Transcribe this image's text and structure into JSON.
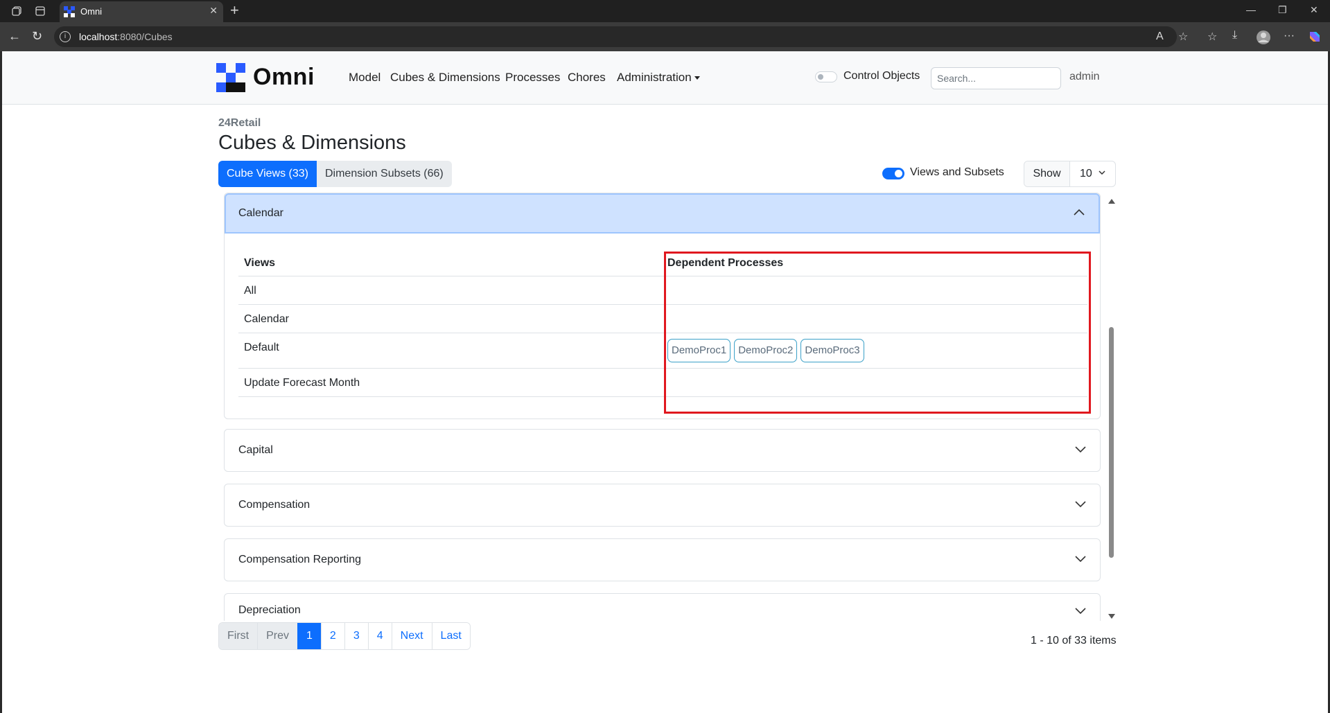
{
  "browser": {
    "tab_title": "Omni",
    "url_host": "localhost",
    "url_path": ":8080/Cubes"
  },
  "navbar": {
    "brand": "Omni",
    "links": [
      "Model",
      "Cubes & Dimensions",
      "Processes",
      "Chores",
      "Administration"
    ],
    "control_objects_label": "Control Objects",
    "control_objects_on": false,
    "search_placeholder": "Search...",
    "user": "admin"
  },
  "page": {
    "breadcrumb": "24Retail",
    "title": "Cubes & Dimensions",
    "tabs": [
      "Cube Views (33)",
      "Dimension Subsets (66)"
    ],
    "views_subsets_label": "Views and Subsets",
    "views_subsets_on": true,
    "show_label": "Show",
    "show_value": "10"
  },
  "accordion": {
    "open": {
      "title": "Calendar",
      "views_header": "Views",
      "deps_header": "Dependent Processes",
      "rows": [
        {
          "view": "All",
          "processes": []
        },
        {
          "view": "Calendar",
          "processes": []
        },
        {
          "view": "Default",
          "processes": [
            "DemoProc1",
            "DemoProc2",
            "DemoProc3"
          ]
        },
        {
          "view": "Update Forecast Month",
          "processes": []
        }
      ]
    },
    "collapsed": [
      "Capital",
      "Compensation",
      "Compensation Reporting",
      "Depreciation"
    ]
  },
  "pagination": {
    "first": "First",
    "prev": "Prev",
    "pages": [
      "1",
      "2",
      "3",
      "4"
    ],
    "current": "1",
    "next": "Next",
    "last": "Last",
    "summary": "1 - 10 of 33 items"
  },
  "colors": {
    "accent": "#0d6efd",
    "highlight": "#e0181f",
    "open_header_bg": "#cfe2ff"
  }
}
